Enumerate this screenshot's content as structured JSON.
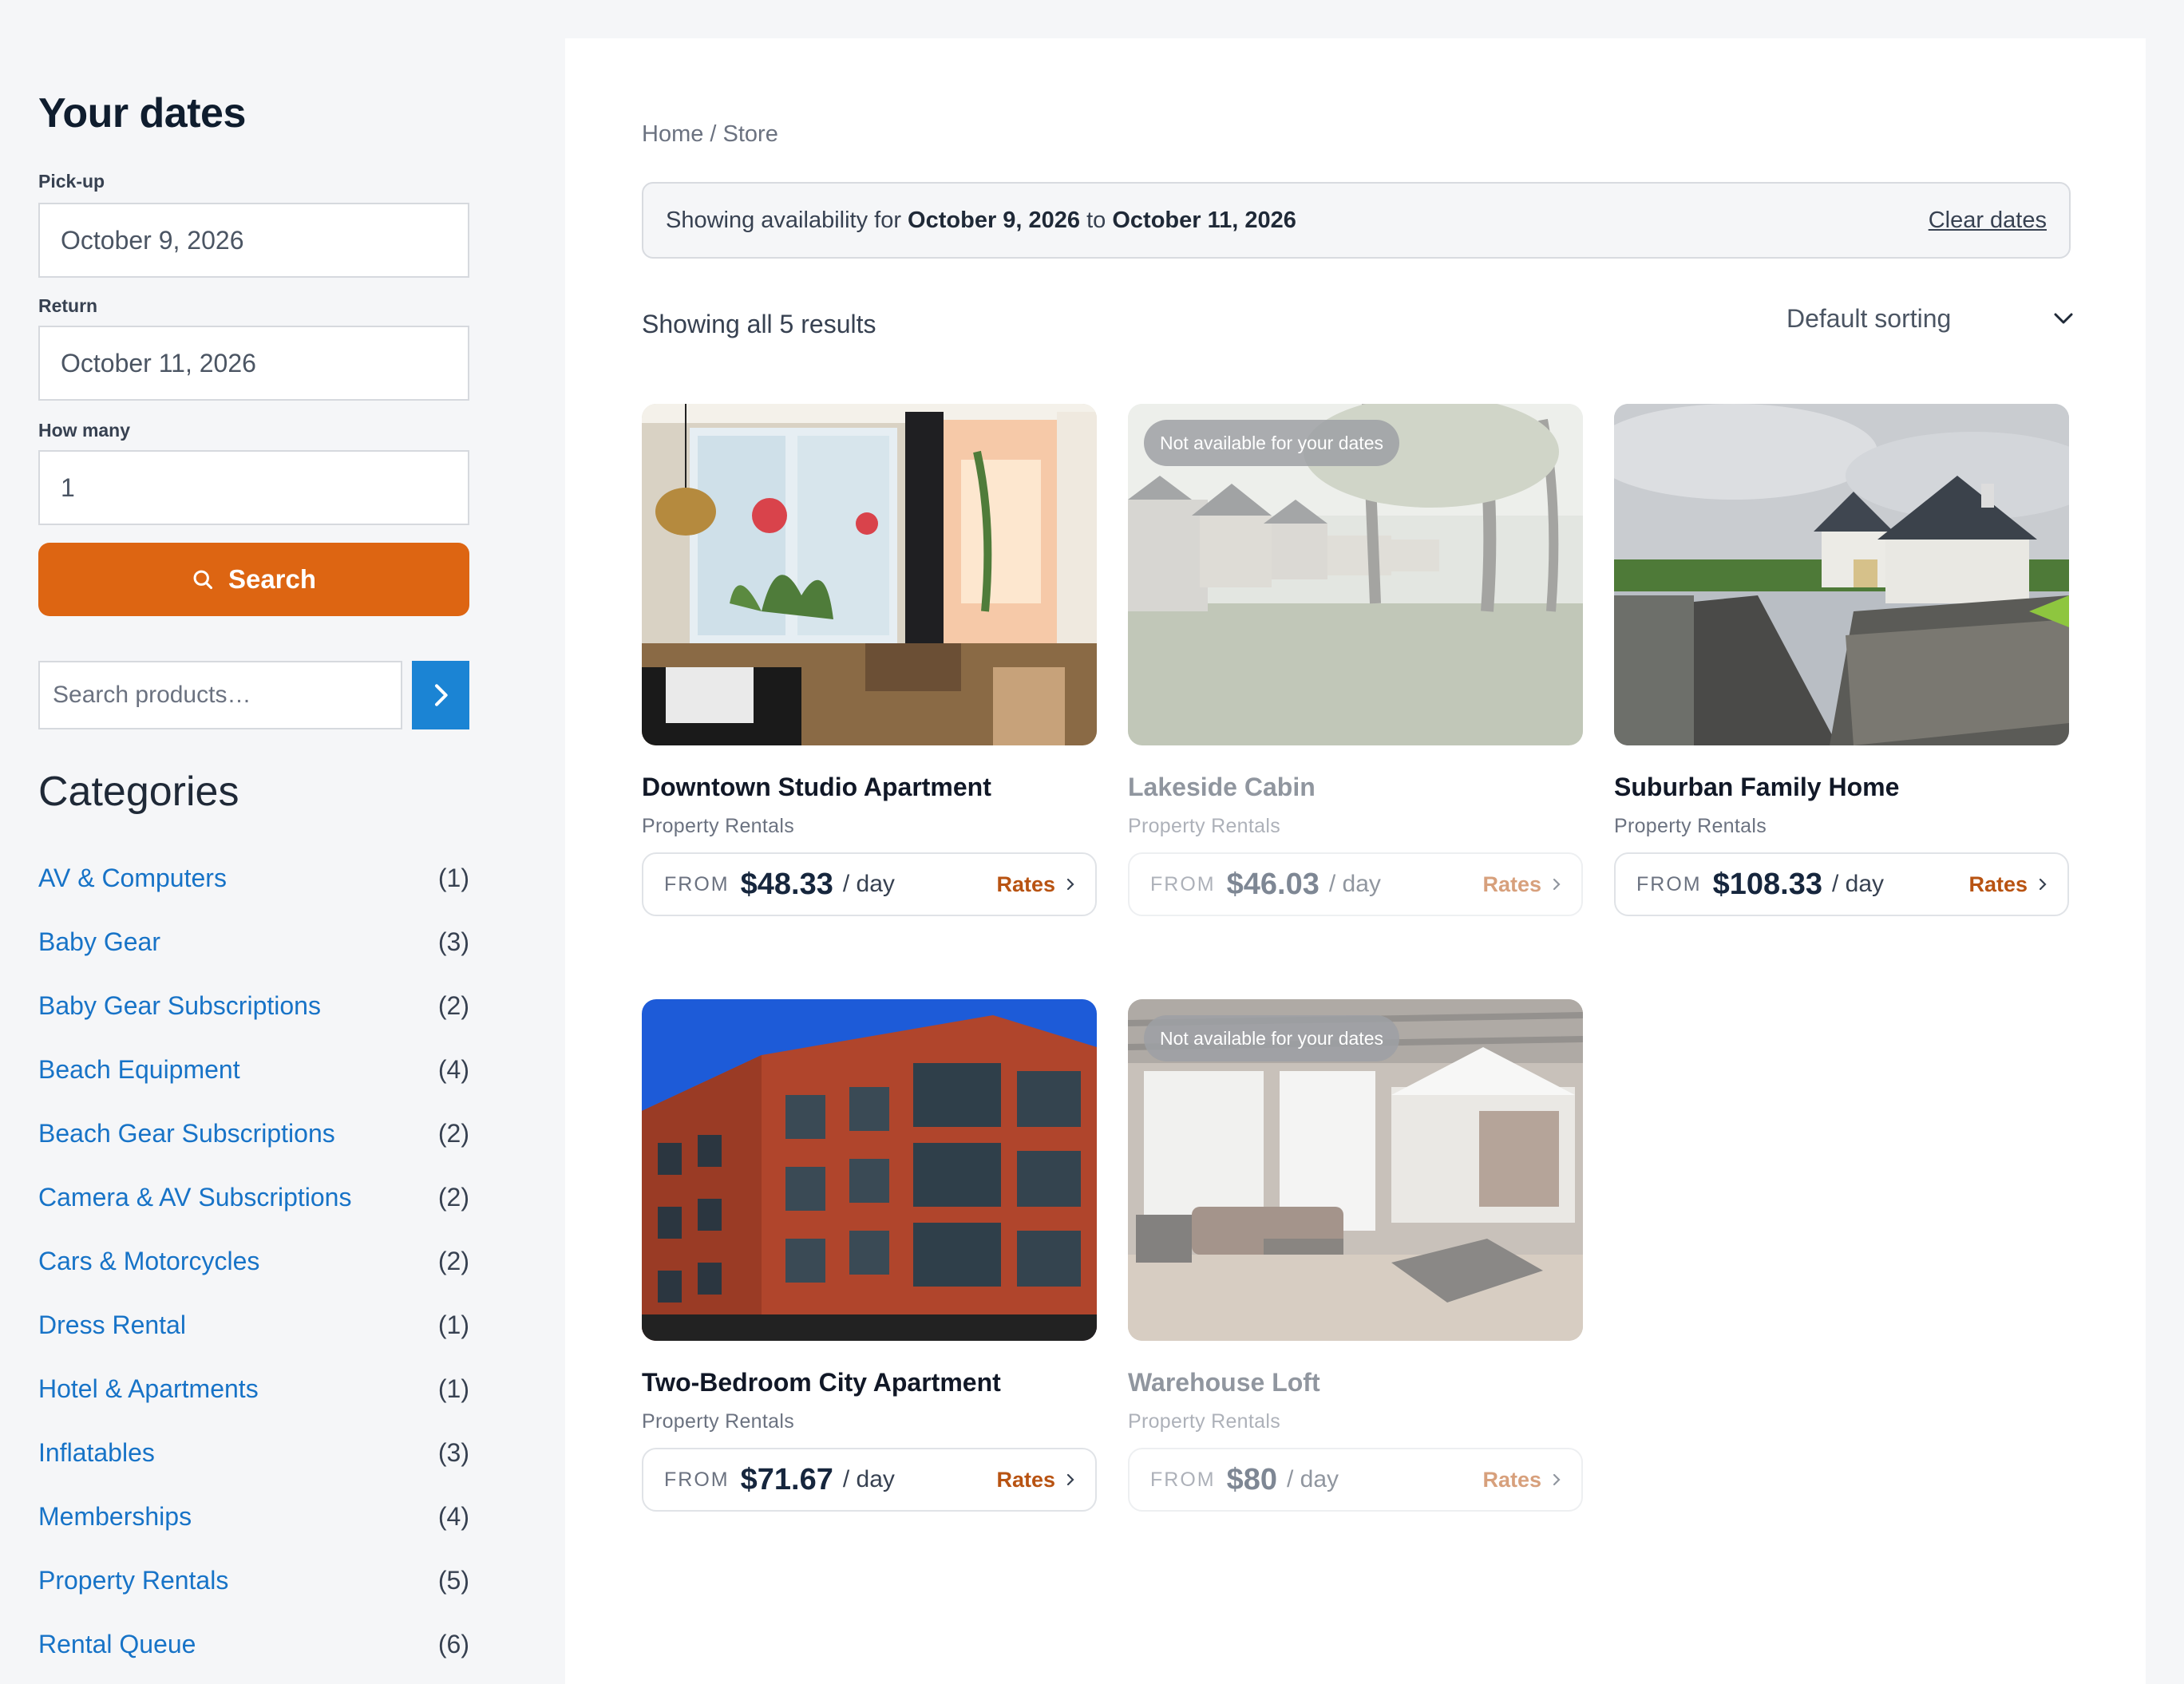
{
  "sidebar": {
    "title": "Your dates",
    "pickup_label": "Pick-up",
    "pickup_value": "October 9, 2026",
    "return_label": "Return",
    "return_value": "October 11, 2026",
    "howmany_label": "How many",
    "howmany_value": "1",
    "search_label": "Search",
    "product_search_placeholder": "Search products…",
    "categories_title": "Categories",
    "categories": [
      {
        "name": "AV & Computers",
        "count": "(1)"
      },
      {
        "name": "Baby Gear",
        "count": "(3)"
      },
      {
        "name": "Baby Gear Subscriptions",
        "count": "(2)"
      },
      {
        "name": "Beach Equipment",
        "count": "(4)"
      },
      {
        "name": "Beach Gear Subscriptions",
        "count": "(2)"
      },
      {
        "name": "Camera & AV Subscriptions",
        "count": "(2)"
      },
      {
        "name": "Cars & Motorcycles",
        "count": "(2)"
      },
      {
        "name": "Dress Rental",
        "count": "(1)"
      },
      {
        "name": "Hotel & Apartments",
        "count": "(1)"
      },
      {
        "name": "Inflatables",
        "count": "(3)"
      },
      {
        "name": "Memberships",
        "count": "(4)"
      },
      {
        "name": "Property Rentals",
        "count": "(5)"
      },
      {
        "name": "Rental Queue",
        "count": "(6)"
      }
    ]
  },
  "main": {
    "breadcrumb": "Home / Store",
    "availability": {
      "prefix": "Showing availability for ",
      "from": "October 9, 2026",
      "middle": " to ",
      "to": "October 11, 2026",
      "clear": "Clear dates"
    },
    "results_count": "Showing all 5 results",
    "sorting": "Default sorting",
    "badge_text": "Not available for your dates",
    "from_label": "FROM",
    "unit_label": "/ day",
    "rates_label": "Rates",
    "products": [
      {
        "title": "Downtown Studio Apartment",
        "category": "Property Rentals",
        "price": "$48.33",
        "available": true
      },
      {
        "title": "Lakeside Cabin",
        "category": "Property Rentals",
        "price": "$46.03",
        "available": false
      },
      {
        "title": "Suburban Family Home",
        "category": "Property Rentals",
        "price": "$108.33",
        "available": true
      },
      {
        "title": "Two-Bedroom City Apartment",
        "category": "Property Rentals",
        "price": "$71.67",
        "available": true
      },
      {
        "title": "Warehouse Loft",
        "category": "Property Rentals",
        "price": "$80",
        "available": false
      }
    ]
  },
  "colors": {
    "accent_orange": "#dd6512",
    "link_blue": "#1773c7",
    "button_blue": "#1b84d4"
  }
}
